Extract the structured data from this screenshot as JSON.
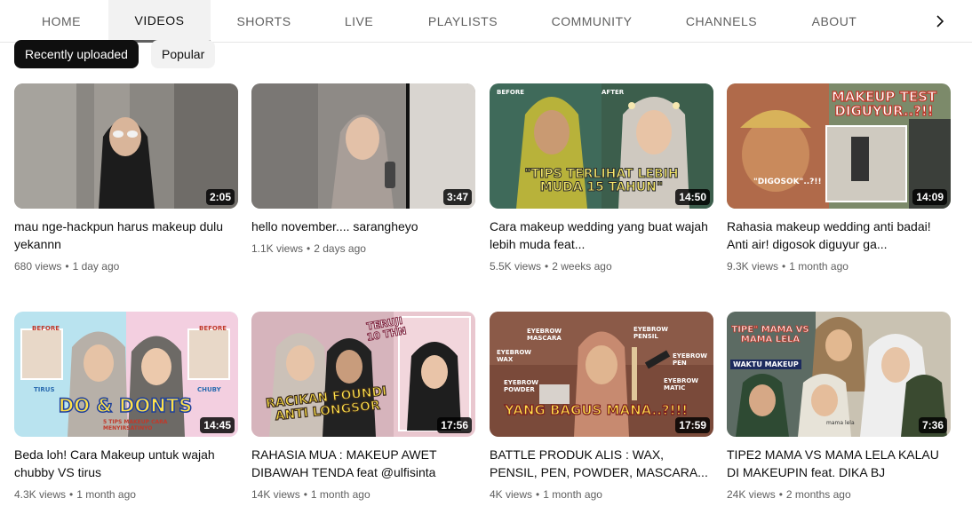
{
  "tabs": [
    "HOME",
    "VIDEOS",
    "SHORTS",
    "LIVE",
    "PLAYLISTS",
    "COMMUNITY",
    "CHANNELS",
    "ABOUT"
  ],
  "active_tab": "VIDEOS",
  "chips": {
    "selected": "Recently uploaded",
    "other": "Popular"
  },
  "videos": [
    {
      "title": "mau nge-hackpun harus makeup dulu yekannn",
      "duration": "2:05",
      "views": "680 views",
      "age": "1 day ago",
      "overlay": ""
    },
    {
      "title": "hello november.... sarangheyo",
      "duration": "3:47",
      "views": "1.1K views",
      "age": "2 days ago",
      "overlay": ""
    },
    {
      "title": "Cara makeup wedding yang buat wajah lebih muda feat...",
      "duration": "14:50",
      "views": "5.5K views",
      "age": "2 weeks ago",
      "overlay": "\"TIPS TERLIHAT LEBIH MUDA 15 TAHUN\"",
      "tag1": "BEFORE",
      "tag2": "AFTER"
    },
    {
      "title": "Rahasia makeup wedding anti badai! Anti air! digosok diguyur ga...",
      "duration": "14:09",
      "views": "9.3K views",
      "age": "1 month ago",
      "overlay": "MAKEUP TEST DIGUYUR..?!!",
      "tag1": "\"DIGOSOK\"..?!!"
    },
    {
      "title": "Beda loh! Cara Makeup untuk wajah chubby VS tirus",
      "duration": "14:45",
      "views": "4.3K views",
      "age": "1 month ago",
      "overlay": "DO & DONTS",
      "tag1": "BEFORE",
      "tag2": "BEFORE",
      "tag3": "TIRUS",
      "tag4": "CHUBY",
      "tag5": "5 TIPS MAKEUP CARA MENYIRSATINYO"
    },
    {
      "title": "RAHASIA MUA : MAKEUP AWET DIBAWAH TENDA feat @ulfisinta",
      "duration": "17:56",
      "views": "14K views",
      "age": "1 month ago",
      "overlay": "RACIKAN FOUNDI ANTI LONGSOR",
      "tag1": "TERUJI 10 THN"
    },
    {
      "title": "BATTLE PRODUK ALIS : WAX, PENSIL, PEN, POWDER, MASCARA...",
      "duration": "17:59",
      "views": "4K views",
      "age": "1 month ago",
      "overlay": "YANG BAGUS MANA..?!!!",
      "tags": [
        "EYEBROW MASCARA",
        "EYEBROW PENSIL",
        "EYEBROW WAX",
        "EYEBROW PEN",
        "EYEBROW POWDER",
        "EYEBROW MATIC"
      ]
    },
    {
      "title": "TIPE2 MAMA VS MAMA LELA KALAU DI MAKEUPIN feat. DIKA BJ",
      "duration": "7:36",
      "views": "24K views",
      "age": "2 months ago",
      "overlay": "TIPE\" MAMA VS MAMA LELA",
      "tag1": "WAKTU MAKEUP",
      "tag2": "mama lela"
    }
  ],
  "icons": {
    "next": "chevron-right-icon"
  }
}
